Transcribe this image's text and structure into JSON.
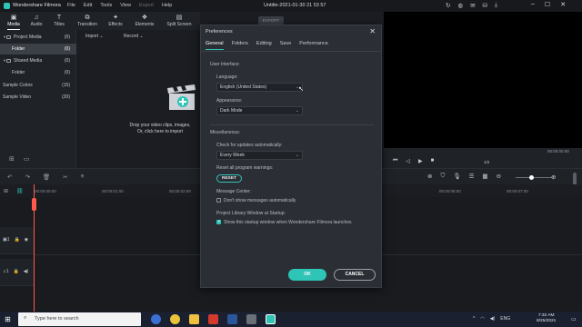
{
  "titlebar": {
    "app_name": "Wondershare Filmora",
    "menu": [
      "File",
      "Edit",
      "Tools",
      "View",
      "Export",
      "Help"
    ],
    "document_title": "Untitle-2021-01-30 21 53 57"
  },
  "toolbar": {
    "tabs": [
      {
        "label": "Media",
        "icon": "folder-icon"
      },
      {
        "label": "Audio",
        "icon": "music-icon"
      },
      {
        "label": "Titles",
        "icon": "title-icon"
      },
      {
        "label": "Transition",
        "icon": "transition-icon"
      },
      {
        "label": "Effects",
        "icon": "effects-icon"
      },
      {
        "label": "Elements",
        "icon": "elements-icon"
      },
      {
        "label": "Split Screen",
        "icon": "split-screen-icon"
      }
    ],
    "export_label": "EXPORT"
  },
  "sidebar": {
    "items": [
      {
        "label": "Project Media",
        "count": "(0)"
      },
      {
        "label": "Folder",
        "count": "(0)"
      },
      {
        "label": "Shared Media",
        "count": "(0)"
      },
      {
        "label": "Folder",
        "count": "(0)"
      },
      {
        "label": "Sample Colors",
        "count": "(15)"
      },
      {
        "label": "Sample Video",
        "count": "(20)"
      }
    ]
  },
  "media": {
    "import_label": "Import",
    "record_label": "Record",
    "drop_line1": "Drop your video clips, images,",
    "drop_line2": "Or, click here to import"
  },
  "preview": {
    "timecode": "00:00:00:00",
    "page": "1/2"
  },
  "timeline": {
    "ticks": [
      "00:00:00:00",
      "00:00:01:00",
      "00:00:02:00",
      "00:00:06:00",
      "00:00:07:00"
    ]
  },
  "dialog": {
    "title": "Preferences",
    "tabs": [
      "General",
      "Folders",
      "Editing",
      "Save",
      "Performance"
    ],
    "user_interface_heading": "User Interface:",
    "language_label": "Language:",
    "language_value": "English (United States)",
    "appearance_label": "Appearance:",
    "appearance_value": "Dark Mode",
    "misc_heading": "Miscellaneous:",
    "updates_label": "Check for updates automatically:",
    "updates_value": "Every Week",
    "reset_warnings_label": "Reset all program warnings:",
    "reset_button": "RESET",
    "message_center_label": "Message Center:",
    "dont_show_messages": "Don't show messages automatically",
    "library_label": "Project Library Window at Startup:",
    "show_startup": "Show this startup window when Wondershare Filmora launches",
    "ok_button": "OK",
    "cancel_button": "CANCEL"
  },
  "taskbar": {
    "search_placeholder": "Type here to search",
    "language": "ENG",
    "time": "7:32 AM",
    "date": "8/25/2021"
  },
  "colors": {
    "accent": "#2ec4b6",
    "playhead": "#ff5a4c"
  }
}
